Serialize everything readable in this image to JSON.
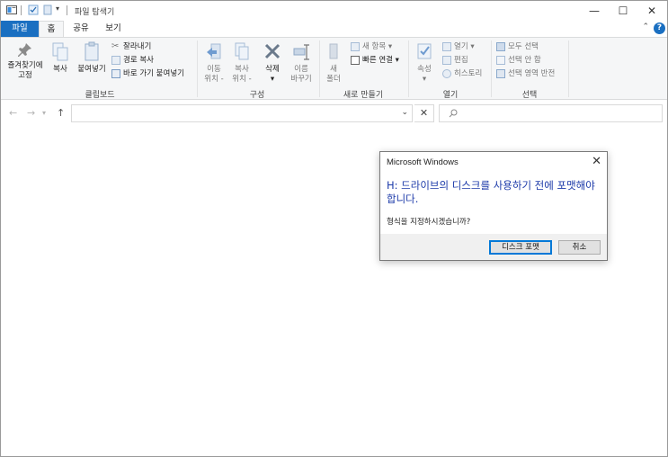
{
  "titlebar": {
    "title": "파일 탐색기",
    "minimize": "—",
    "maximize": "☐",
    "close": "✕"
  },
  "tabs": [
    "파일",
    "홈",
    "공유",
    "보기"
  ],
  "help_label": "?",
  "ribbon": {
    "clipboard": {
      "label": "클립보드",
      "pin_label": "즐겨찾기에\n고정",
      "copy_label": "복사",
      "paste_label": "붙여넣기",
      "cut_label": "잘라내기",
      "copy_path_label": "경로 복사",
      "paste_shortcut_label": "바로 가기 붙여넣기"
    },
    "organize": {
      "label": "구성",
      "move_to_label": "이동\n위치 -",
      "copy_to_label": "복사\n위치 -",
      "delete_label": "삭제\n▾",
      "rename_label": "이름\n바꾸기"
    },
    "new": {
      "label": "새로 만들기",
      "new_folder_label": "새\n폴더",
      "new_item_label": "새 항목 ▾",
      "easy_access_label": "빠른 연결 ▾"
    },
    "open": {
      "label": "열기",
      "properties_label": "속성\n▾",
      "open_label": "열기 ▾",
      "edit_label": "편집",
      "history_label": "히스토리"
    },
    "select": {
      "label": "선택",
      "select_all_label": "모두 선택",
      "select_none_label": "선택 안 함",
      "invert_label": "선택 영역 반전"
    }
  },
  "navbar": {
    "back": "←",
    "forward": "→",
    "recent": "▾",
    "up": "↑",
    "address_value": "",
    "address_dropdown": "⌄",
    "address_clear": "✕",
    "search_placeholder": ""
  },
  "dialog": {
    "title": "Microsoft Windows",
    "close": "✕",
    "message": "H: 드라이브의 디스크를 사용하기 전에 포맷해야 합니다.",
    "question": "형식을 지정하시겠습니까?",
    "format_button": "디스크 포맷",
    "cancel_button": "취소"
  },
  "colors": {
    "accent": "#1a6fc1",
    "dialog_message": "#1c3aa9",
    "primary_border": "#0078d7"
  }
}
